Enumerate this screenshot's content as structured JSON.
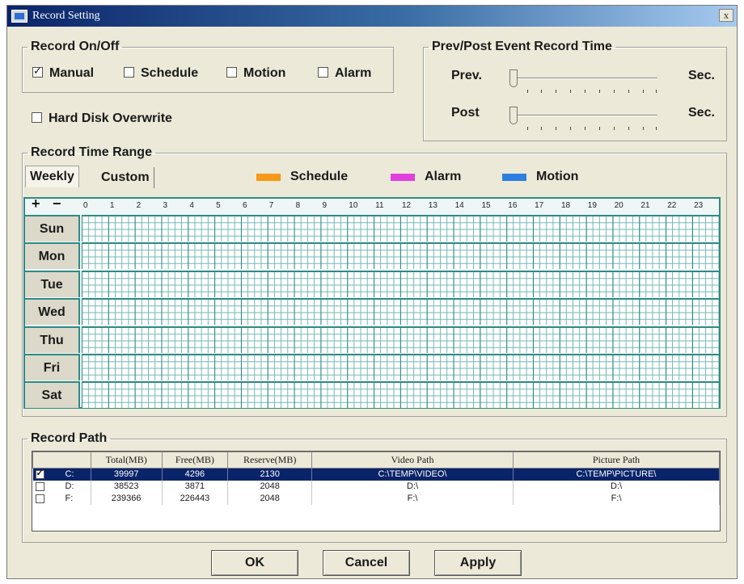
{
  "window": {
    "title": "Record Setting",
    "close_label": "x"
  },
  "record_onoff": {
    "legend": "Record On/Off",
    "options": [
      {
        "label": "Manual",
        "checked": true
      },
      {
        "label": "Schedule",
        "checked": false
      },
      {
        "label": "Motion",
        "checked": false
      },
      {
        "label": "Alarm",
        "checked": false
      }
    ],
    "hdd_overwrite": {
      "label": "Hard Disk Overwrite",
      "checked": false
    }
  },
  "prevpost": {
    "legend": "Prev/Post Event Record Time",
    "prev_label": "Prev.",
    "post_label": "Post",
    "unit": "Sec."
  },
  "time_range": {
    "legend": "Record Time Range",
    "tabs": [
      "Weekly",
      "Custom"
    ],
    "legend_items": [
      {
        "label": "Schedule",
        "color": "#f59a17"
      },
      {
        "label": "Alarm",
        "color": "#e23fe0"
      },
      {
        "label": "Motion",
        "color": "#2d7fe0"
      }
    ],
    "plus": "+",
    "minus": "−",
    "hours": [
      "0",
      "1",
      "2",
      "3",
      "4",
      "5",
      "6",
      "7",
      "8",
      "9",
      "10",
      "11",
      "12",
      "13",
      "14",
      "15",
      "16",
      "17",
      "18",
      "19",
      "20",
      "21",
      "22",
      "23"
    ],
    "days": [
      "Sun",
      "Mon",
      "Tue",
      "Wed",
      "Thu",
      "Fri",
      "Sat"
    ]
  },
  "record_path": {
    "legend": "Record Path",
    "columns": [
      "",
      "Total(MB)",
      "Free(MB)",
      "Reserve(MB)",
      "Video Path",
      "Picture Path"
    ],
    "rows": [
      {
        "checked": true,
        "selected": true,
        "drive": "C:",
        "total": "39997",
        "free": "4296",
        "reserve": "2130",
        "video": "C:\\TEMP\\VIDEO\\",
        "picture": "C:\\TEMP\\PICTURE\\"
      },
      {
        "checked": false,
        "selected": false,
        "drive": "D:",
        "total": "38523",
        "free": "3871",
        "reserve": "2048",
        "video": "D:\\",
        "picture": "D:\\"
      },
      {
        "checked": false,
        "selected": false,
        "drive": "F:",
        "total": "239366",
        "free": "226443",
        "reserve": "2048",
        "video": "F:\\",
        "picture": "F:\\"
      }
    ]
  },
  "buttons": {
    "ok": "OK",
    "cancel": "Cancel",
    "apply": "Apply"
  }
}
